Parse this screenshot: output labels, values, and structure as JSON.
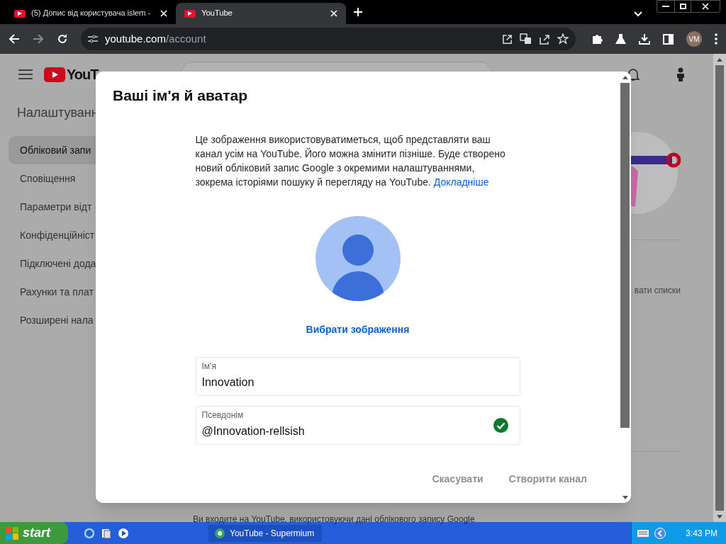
{
  "browser": {
    "tabs": [
      {
        "title": "(5) Допис від користувача islem -",
        "selected": false
      },
      {
        "title": "YouTube",
        "selected": true
      }
    ],
    "url_host": "youtube.com",
    "url_path": "/account",
    "profile_initials": "VM"
  },
  "page": {
    "logo_text": "YouT",
    "sidebar_heading": "Налаштуванн",
    "sidebar_items": [
      {
        "label": "Обліковий запи",
        "selected": true
      },
      {
        "label": "Сповіщення",
        "selected": false
      },
      {
        "label": "Параметри відт",
        "selected": false
      },
      {
        "label": "Конфіденційніст",
        "selected": false
      },
      {
        "label": "Підключені дода",
        "selected": false
      },
      {
        "label": "Рахунки та плат",
        "selected": false
      },
      {
        "label": "Розширені нала",
        "selected": false
      }
    ],
    "side_text": "вати списки",
    "footer_text": "Ви входите на YouTube, використовуючи дані облікового запису Google"
  },
  "dialog": {
    "title": "Ваші ім'я й аватар",
    "description": "Це зображення використовуватиметься, щоб представляти ваш канал усім на YouTube. Його можна змінити пізніше. Буде створено новий обліковий запис Google з окремими налаштуваннями, зокрема історіями пошуку й перегляду на YouTube.",
    "link": "Докладніше",
    "choose_image": "Вибрати зображення",
    "fields": [
      {
        "label": "Ім'я",
        "value": "Innovation",
        "verified": false
      },
      {
        "label": "Псевдонім",
        "value": "@Innovation-rellsish",
        "verified": true
      }
    ],
    "buttons": [
      {
        "label": "Скасувати",
        "disabled": true
      },
      {
        "label": "Створити канал",
        "disabled": true
      }
    ]
  },
  "taskbar": {
    "start": "start",
    "tasks": [
      {
        "label": "YouTube - Supermium"
      }
    ],
    "clock": "3:43 PM"
  }
}
